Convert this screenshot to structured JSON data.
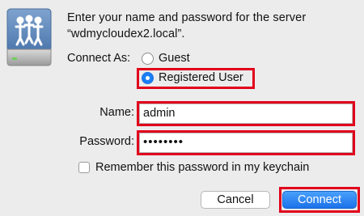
{
  "dialog": {
    "message_line1": "Enter your name and password for the server",
    "message_line2": "“wdmycloudex2.local”.",
    "connect_as_label": "Connect As:",
    "options": [
      {
        "label": "Guest",
        "selected": false
      },
      {
        "label": "Registered User",
        "selected": true
      }
    ],
    "name_label": "Name:",
    "name_value": "admin",
    "password_label": "Password:",
    "password_mask": "••••••••",
    "remember_label": "Remember this password in my keychain",
    "remember_checked": false,
    "cancel_label": "Cancel",
    "connect_label": "Connect"
  },
  "icons": {
    "server": "network-server-icon"
  },
  "colors": {
    "highlight": "#e1001c",
    "accent": "#1b7ef5"
  }
}
